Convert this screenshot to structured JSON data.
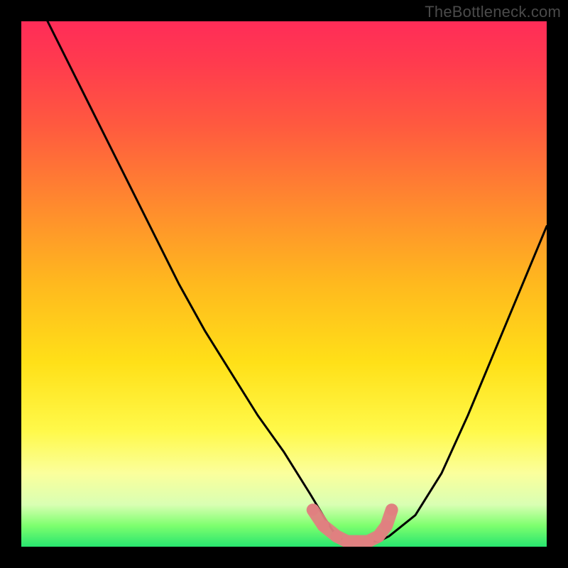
{
  "watermark": "TheBottleneck.com",
  "chart_data": {
    "type": "line",
    "title": "",
    "xlabel": "",
    "ylabel": "",
    "xlim": [
      0,
      100
    ],
    "ylim": [
      0,
      100
    ],
    "series": [
      {
        "name": "bottleneck-curve",
        "x": [
          5,
          10,
          15,
          20,
          25,
          30,
          35,
          40,
          45,
          50,
          55,
          58,
          60,
          62,
          65,
          68,
          70,
          75,
          80,
          85,
          90,
          95,
          100
        ],
        "y": [
          100,
          90,
          80,
          70,
          60,
          50,
          41,
          33,
          25,
          18,
          10,
          5,
          2,
          1,
          1,
          1,
          2,
          6,
          14,
          25,
          37,
          49,
          61
        ]
      }
    ],
    "marker_region": {
      "x": [
        55.5,
        57.5,
        60,
        62,
        64,
        66,
        68,
        69.5,
        70.5
      ],
      "y": [
        7,
        4,
        2,
        1,
        1,
        1,
        2,
        4,
        7
      ]
    },
    "colors": {
      "curve": "#000000",
      "marker": "#e08080",
      "gradient_top": "#ff2c58",
      "gradient_mid": "#ffe018",
      "gradient_bottom": "#28e56f",
      "frame": "#000000"
    }
  }
}
